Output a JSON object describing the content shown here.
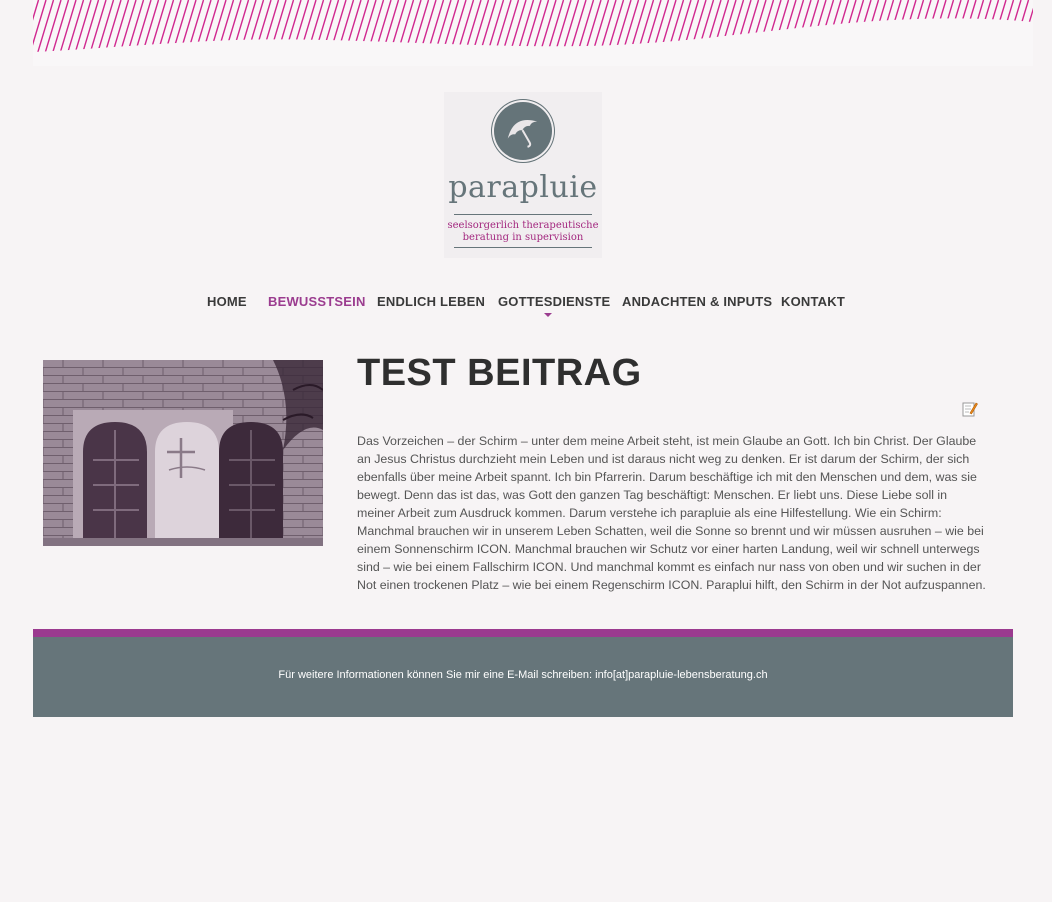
{
  "logo": {
    "brand": "parapluie",
    "tagline_line1": "seelsorgerlich therapeutische",
    "tagline_line2": "beratung in supervision"
  },
  "nav": {
    "items": [
      {
        "label": "HOME"
      },
      {
        "label": "BEWUSSTSEIN",
        "active": true
      },
      {
        "label": "ENDLICH LEBEN"
      },
      {
        "label": "GOTTESDIENSTE",
        "has_submenu": true
      },
      {
        "label": "ANDACHTEN & INPUTS"
      },
      {
        "label": "KONTAKT"
      }
    ]
  },
  "article": {
    "title": "TEST BEITRAG",
    "body": "Das Vorzeichen – der Schirm – unter dem meine Arbeit steht, ist mein Glaube an Gott. Ich bin Christ. Der Glaube an Jesus Christus durchzieht mein Leben und ist daraus nicht weg zu denken. Er ist darum der Schirm, der sich ebenfalls über meine Arbeit spannt. Ich bin Pfarrerin. Darum beschäftige ich mit den Menschen und dem, was sie bewegt. Denn das ist das, was Gott den ganzen Tag beschäftigt: Menschen. Er liebt uns. Diese Liebe soll in meiner Arbeit zum Ausdruck kommen. Darum verstehe ich parapluie als eine Hilfestellung. Wie ein Schirm: Manchmal brauchen wir in unserem Leben Schatten, weil die Sonne so brennt und wir müssen ausruhen – wie bei einem Sonnenschirm ICON. Manchmal brauchen wir Schutz vor einer harten Landung, weil wir schnell unterwegs sind – wie bei einem Fallschirm ICON. Und manchmal kommt es einfach nur nass von oben und wir suchen in der Not einen trockenen Platz – wie bei einem Regenschirm ICON. Paraplui hilft, den Schirm in der Not aufzuspannen."
  },
  "footer": {
    "text": "Für weitere Informationen können Sie mir eine E-Mail schreiben: info[at]parapluie-lebensberatung.ch"
  },
  "colors": {
    "accent": "#9b3c8f",
    "footer": "#66757a",
    "background": "#f7f4f5"
  }
}
